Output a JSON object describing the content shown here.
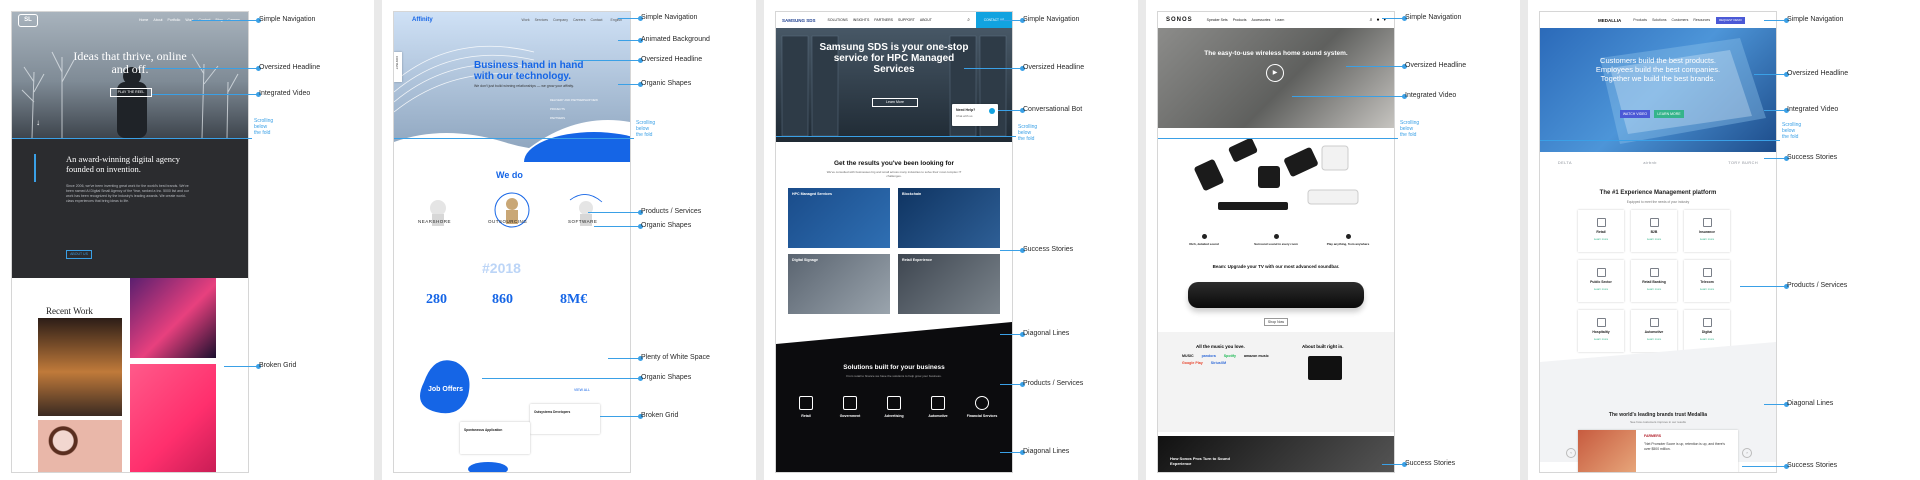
{
  "annotations": {
    "panel1": [
      "Simple Navigation",
      "Oversized Headline",
      "Integrated Video",
      "Broken Grid"
    ],
    "panel2": [
      "Simple Navigation",
      "Animated Background",
      "Oversized Headline",
      "Organic Shapes",
      "Products / Services",
      "Organic Shapes",
      "Plenty of White Space",
      "Organic Shapes",
      "Broken Grid"
    ],
    "panel3": [
      "Simple Navigation",
      "Oversized Headline",
      "Conversational Bot",
      "Success Stories",
      "Diagonal Lines",
      "Products / Services",
      "Diagonal Lines"
    ],
    "panel4": [
      "Simple Navigation",
      "Oversized Headline",
      "Integrated Video",
      "Success Stories"
    ],
    "panel5": [
      "Simple Navigation",
      "Oversized Headline",
      "Integrated Video",
      "Success Stories",
      "Products / Services",
      "Diagonal Lines",
      "Success Stories"
    ]
  },
  "fold_note": "Scrolling\nbelow\nthe fold",
  "site1": {
    "logo": "SL",
    "nav": [
      "Home",
      "About",
      "Portfolio",
      "Work",
      "Contact",
      "Blog",
      "Careers"
    ],
    "headline": "Ideas that thrive, online and off.",
    "cta": "PLAY THE REEL",
    "section_title": "An award-winning digital agency founded on invention.",
    "body": "Since 2006, we've been inventing great work for the world's best brands. We've been named AI Digital Small Agency of the Year, ranked a Inc. 5000 list and our work has been recognized by the industry's leading awards. We create world-class experiences that bring ideas to life.",
    "button": "ABOUT US",
    "recent": "Recent Work"
  },
  "site2": {
    "logo": "Affinity",
    "nav": [
      "Work",
      "Services",
      "Company",
      "Careers",
      "Contact"
    ],
    "lang": "English",
    "headline": "Business hand in hand with our technology.",
    "sub": "We don't just build winning relationships — we grow your affinity.",
    "stats_small": [
      "DELIVERY AND PARTNERSHIP NEW",
      "PROJECTS",
      "PARTNERS"
    ],
    "we_do": "We do",
    "services": [
      "NEARSHORE",
      "OUTSOURCING",
      "SOFTWARE"
    ],
    "year": "#2018",
    "numbers": [
      "280",
      "860",
      "8M€"
    ],
    "job": "Job Offers",
    "view_all": "VIEW ALL",
    "job1": "Spontaneous Application",
    "job2": "Outsystems Developers",
    "side_tab": "CONTACT"
  },
  "site3": {
    "logo": "SAMSUNG SDS",
    "nav": [
      "SOLUTIONS",
      "INSIGHTS",
      "PARTNERS",
      "SUPPORT",
      "ABOUT"
    ],
    "cta": "CONTACT US",
    "headline": "Samsung SDS is your one-stop service for HPC Managed Services",
    "learn": "Learn More",
    "bot_title": "Need Help?",
    "bot_sub": "Chat with us",
    "results_title": "Get the results you've been looking for",
    "results_sub": "We've consulted with businesses big and small across many industries to solve their most complex IT challenges.",
    "cards": [
      "HPC Managed Services",
      "Blockchain",
      "Digital Signage",
      "Retail Experience"
    ],
    "solutions_title": "Solutions built for your business",
    "solutions_sub": "From retail to finance we have the solutions to help grow your business.",
    "solutions": [
      "Retail",
      "Government",
      "Advertising",
      "Automotive",
      "Financial Services"
    ]
  },
  "site4": {
    "logo": "SONOS",
    "nav": [
      "Speaker Sets",
      "Products",
      "Accessories",
      "Learn"
    ],
    "headline": "The easy-to-use wireless home sound system.",
    "features": [
      "Rich, detailed sound",
      "Surround sound in every room",
      "Play anything, from anywhere"
    ],
    "beam": "Beam: Upgrade your TV with our most advanced soundbar.",
    "beam_btn": "Shop Now",
    "music_title": "All the music you love.",
    "brands": [
      "MUSIC",
      "pandora",
      "Spotify",
      "amazon music",
      "Google Play",
      "SiriusXM"
    ],
    "about_title": "About built right in.",
    "story_title": "How Sonos Pros Turn to Sound Experience"
  },
  "site5": {
    "logo": "MEDALLIA",
    "nav": [
      "Products",
      "Solutions",
      "Customers",
      "Resources"
    ],
    "demo": "REQUEST DEMO",
    "headline": "Customers build the best products. Employees build the best companies. Together we build the best brands.",
    "btn1": "WATCH VIDEO",
    "btn2": "LEARN MORE",
    "logos": [
      "DELTA",
      "",
      "airbnb",
      "",
      "TORY BURCH"
    ],
    "platform_title": "The #1 Experience Management platform",
    "platform_sub": "Equipped to meet the needs of your industry",
    "tiles": [
      "Retail",
      "B2B",
      "Insurance",
      "Public Sector",
      "Retail Banking",
      "Telecom",
      "Hospitality",
      "Automotive",
      "Digital"
    ],
    "learn": "Learn more",
    "trust_title": "The world's leading brands trust Medallia",
    "trust_sub": "See how customers improve in our results",
    "story_brand": "FARMERS",
    "quote": "\"Net Promoter Score is up, retention is up, and there's over $500 million."
  },
  "colors": {
    "accent": "#3aa0e6",
    "site1_dark": "#2b2c2f",
    "site2_blue": "#1565e6",
    "site3_dark": "#0c0c0e",
    "site5_green": "#35b48b"
  }
}
